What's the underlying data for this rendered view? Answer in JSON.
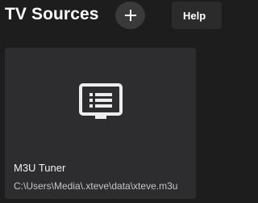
{
  "header": {
    "title": "TV Sources",
    "add_icon": "plus-icon",
    "help_label": "Help"
  },
  "sources": [
    {
      "name": "M3U Tuner",
      "path": "C:\\Users\\Media\\.xteve\\data\\xteve.m3u",
      "icon": "tv-list-icon"
    }
  ],
  "colors": {
    "background": "#1d1d1d",
    "card": "#2d2d2f",
    "add_button": "#3a3a3a",
    "help_button": "#2b2b2b",
    "text": "#ffffff",
    "muted_text": "#c6c6c6"
  }
}
